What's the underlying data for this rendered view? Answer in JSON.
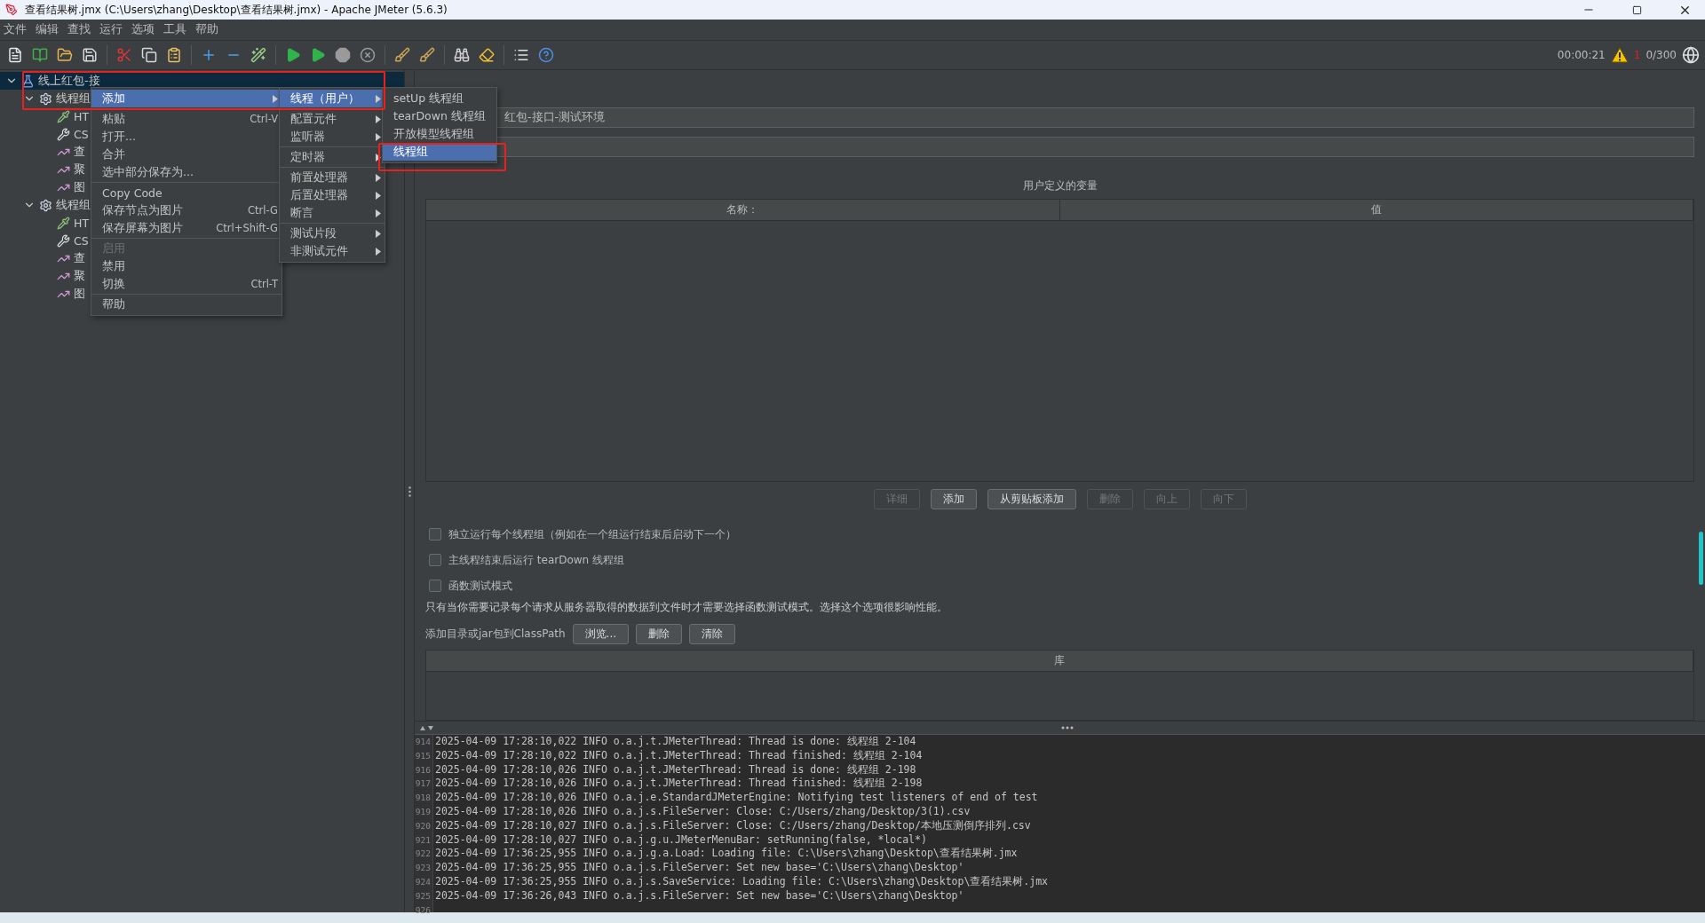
{
  "window": {
    "title": "查看结果树.jmx (C:\\Users\\zhang\\Desktop\\查看结果树.jmx) - Apache JMeter (5.6.3)"
  },
  "menu_bar": [
    "文件",
    "编辑",
    "查找",
    "运行",
    "选项",
    "工具",
    "帮助"
  ],
  "toolbar": {
    "timer": "00:00:21",
    "warning_count": "1",
    "threads": "0/300"
  },
  "tree": [
    {
      "label": "线上红包-接",
      "kind": "test_plan",
      "selected": true,
      "expanded": true,
      "children": [
        {
          "label": "线程组",
          "kind": "thread_group",
          "selected": false,
          "expanded": true,
          "children": [
            {
              "label": "HT",
              "kind": "sampler",
              "selected": false
            },
            {
              "label": "CS",
              "kind": "config",
              "selected": false
            },
            {
              "label": "查",
              "kind": "listener",
              "selected": false
            },
            {
              "label": "聚",
              "kind": "listener",
              "selected": false
            },
            {
              "label": "图",
              "kind": "listener",
              "selected": false
            }
          ]
        },
        {
          "label": "线程组",
          "kind": "thread_group",
          "selected": false,
          "expanded": true,
          "children": [
            {
              "label": "HT",
              "kind": "sampler",
              "selected": false
            },
            {
              "label": "CS",
              "kind": "config",
              "selected": false
            },
            {
              "label": "查",
              "kind": "listener",
              "selected": false
            },
            {
              "label": "聚",
              "kind": "listener",
              "selected": false
            },
            {
              "label": "图",
              "kind": "listener",
              "selected": false
            }
          ]
        }
      ]
    }
  ],
  "context_menus": [
    {
      "groups": [
        [
          {
            "label": "添加",
            "submenu": true,
            "selected": true,
            "disabled": false
          }
        ],
        [
          {
            "label": "粘贴",
            "shortcut": "Ctrl-V",
            "submenu": false,
            "selected": false,
            "disabled": false
          },
          {
            "label": "打开...",
            "submenu": false,
            "selected": false,
            "disabled": false
          },
          {
            "label": "合并",
            "submenu": false,
            "selected": false,
            "disabled": false
          },
          {
            "label": "选中部分保存为...",
            "submenu": false,
            "selected": false,
            "disabled": false
          }
        ],
        [
          {
            "label": "Copy Code",
            "submenu": false,
            "selected": false,
            "disabled": false
          },
          {
            "label": "保存节点为图片",
            "shortcut": "Ctrl-G",
            "submenu": false,
            "selected": false,
            "disabled": false
          },
          {
            "label": "保存屏幕为图片",
            "shortcut": "Ctrl+Shift-G",
            "submenu": false,
            "selected": false,
            "disabled": false
          }
        ],
        [
          {
            "label": "启用",
            "submenu": false,
            "selected": false,
            "disabled": true
          },
          {
            "label": "禁用",
            "submenu": false,
            "selected": false,
            "disabled": false
          },
          {
            "label": "切换",
            "shortcut": "Ctrl-T",
            "submenu": false,
            "selected": false,
            "disabled": false
          }
        ],
        [
          {
            "label": "帮助",
            "submenu": false,
            "selected": false,
            "disabled": false
          }
        ]
      ]
    },
    {
      "groups": [
        [
          {
            "label": "线程（用户）",
            "submenu": true,
            "selected": true,
            "disabled": false
          }
        ],
        [
          {
            "label": "配置元件",
            "submenu": true,
            "selected": false,
            "disabled": false
          },
          {
            "label": "监听器",
            "submenu": true,
            "selected": false,
            "disabled": false
          }
        ],
        [
          {
            "label": "定时器",
            "submenu": true,
            "selected": false,
            "disabled": false
          }
        ],
        [
          {
            "label": "前置处理器",
            "submenu": true,
            "selected": false,
            "disabled": false
          },
          {
            "label": "后置处理器",
            "submenu": true,
            "selected": false,
            "disabled": false
          },
          {
            "label": "断言",
            "submenu": true,
            "selected": false,
            "disabled": false
          }
        ],
        [
          {
            "label": "测试片段",
            "submenu": true,
            "selected": false,
            "disabled": false
          },
          {
            "label": "非测试元件",
            "submenu": true,
            "selected": false,
            "disabled": false
          }
        ]
      ]
    },
    {
      "groups": [
        [
          {
            "label": "setUp 线程组",
            "submenu": false,
            "selected": false,
            "disabled": false
          },
          {
            "label": "tearDown 线程组",
            "submenu": false,
            "selected": false,
            "disabled": false
          },
          {
            "label": "开放模型线程组",
            "submenu": false,
            "selected": false,
            "disabled": false
          },
          {
            "label": "线程组",
            "submenu": false,
            "selected": true,
            "disabled": false
          }
        ]
      ]
    }
  ],
  "panel": {
    "name_field": "红包-接口-测试环境",
    "variables_table": {
      "title": "用户定义的变量",
      "columns": [
        "名称：",
        "值"
      ]
    },
    "table_buttons": [
      {
        "label": "详细",
        "disabled": true
      },
      {
        "label": "添加",
        "disabled": false
      },
      {
        "label": "从剪贴板添加",
        "disabled": false
      },
      {
        "label": "删除",
        "disabled": true
      },
      {
        "label": "向上",
        "disabled": true
      },
      {
        "label": "向下",
        "disabled": true
      }
    ],
    "options": [
      {
        "label": "独立运行每个线程组（例如在一个组运行结束后启动下一个）",
        "checked": false
      },
      {
        "label": "主线程结束后运行 tearDown 线程组",
        "checked": false
      },
      {
        "label": "函数测试模式",
        "checked": false
      }
    ],
    "note": "只有当你需要记录每个请求从服务器取得的数据到文件时才需要选择函数测试模式。选择这个选项很影响性能。",
    "classpath": {
      "label": "添加目录或jar包到ClassPath",
      "buttons": [
        "浏览...",
        "删除",
        "清除"
      ]
    },
    "library_table": {
      "columns": [
        "库"
      ]
    }
  },
  "log": {
    "lines": [
      {
        "line": "914",
        "text": "2025-04-09 17:28:10,022 INFO o.a.j.t.JMeterThread: Thread is done: 线程组 2-104"
      },
      {
        "line": "915",
        "text": "2025-04-09 17:28:10,022 INFO o.a.j.t.JMeterThread: Thread finished: 线程组 2-104"
      },
      {
        "line": "916",
        "text": "2025-04-09 17:28:10,026 INFO o.a.j.t.JMeterThread: Thread is done: 线程组 2-198"
      },
      {
        "line": "917",
        "text": "2025-04-09 17:28:10,026 INFO o.a.j.t.JMeterThread: Thread finished: 线程组 2-198"
      },
      {
        "line": "918",
        "text": "2025-04-09 17:28:10,026 INFO o.a.j.e.StandardJMeterEngine: Notifying test listeners of end of test"
      },
      {
        "line": "919",
        "text": "2025-04-09 17:28:10,026 INFO o.a.j.s.FileServer: Close: C:/Users/zhang/Desktop/3(1).csv"
      },
      {
        "line": "920",
        "text": "2025-04-09 17:28:10,027 INFO o.a.j.s.FileServer: Close: C:/Users/zhang/Desktop/本地压测倒序排列.csv"
      },
      {
        "line": "921",
        "text": "2025-04-09 17:28:10,027 INFO o.a.j.g.u.JMeterMenuBar: setRunning(false, *local*)"
      },
      {
        "line": "922",
        "text": "2025-04-09 17:36:25,955 INFO o.a.j.g.a.Load: Loading file: C:\\Users\\zhang\\Desktop\\查看结果树.jmx"
      },
      {
        "line": "923",
        "text": "2025-04-09 17:36:25,955 INFO o.a.j.s.FileServer: Set new base='C:\\Users\\zhang\\Desktop'"
      },
      {
        "line": "924",
        "text": "2025-04-09 17:36:25,955 INFO o.a.j.s.SaveService: Loading file: C:\\Users\\zhang\\Desktop\\查看结果树.jmx"
      },
      {
        "line": "925",
        "text": "2025-04-09 17:36:26,043 INFO o.a.j.s.FileServer: Set new base='C:\\Users\\zhang\\Desktop'"
      },
      {
        "line": "926"
      }
    ]
  }
}
